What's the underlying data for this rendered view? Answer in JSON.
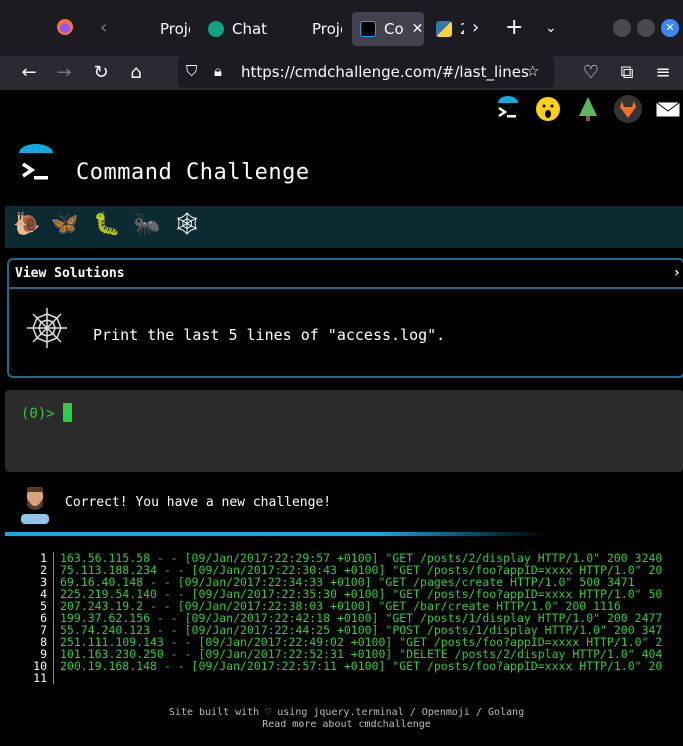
{
  "tabs": [
    {
      "label": "Proje"
    },
    {
      "label": "Chat"
    },
    {
      "label": "Proje"
    },
    {
      "label": "Co"
    },
    {
      "label": "2"
    }
  ],
  "url": "https://cmdchallenge.com/#/last_lines",
  "page": {
    "title": "Command Challenge",
    "solutions_label": "View Solutions",
    "task": "Print the last 5 lines of \"access.log\".",
    "prompt": "(0)>",
    "message": "Correct! You have a new challenge!",
    "output": [
      {
        "n": "1",
        "text": "163.56.115.58 - - [09/Jan/2017:22:29:57 +0100] \"GET /posts/2/display HTTP/1.0\" 200 3240"
      },
      {
        "n": "2",
        "text": "75.113.188.234 - - [09/Jan/2017:22:30:43 +0100] \"GET /posts/foo?appID=xxxx HTTP/1.0\" 20"
      },
      {
        "n": "3",
        "text": "69.16.40.148 - - [09/Jan/2017:22:34:33 +0100] \"GET /pages/create HTTP/1.0\" 500 3471"
      },
      {
        "n": "4",
        "text": "225.219.54.140 - - [09/Jan/2017:22:35:30 +0100] \"GET /posts/foo?appID=xxxx HTTP/1.0\" 50"
      },
      {
        "n": "5",
        "text": "207.243.19.2 - - [09/Jan/2017:22:38:03 +0100] \"GET /bar/create HTTP/1.0\" 200 1116"
      },
      {
        "n": "6",
        "text": "199.37.62.156 - - [09/Jan/2017:22:42:18 +0100] \"GET /posts/1/display HTTP/1.0\" 200 2477"
      },
      {
        "n": "7",
        "text": "55.74.240.123 - - [09/Jan/2017:22:44:25 +0100] \"POST /posts/1/display HTTP/1.0\" 200 347"
      },
      {
        "n": "8",
        "text": "251.111.109.143 - - [09/Jan/2017:22:49:02 +0100] \"GET /posts/foo?appID=xxxx HTTP/1.0\" 2"
      },
      {
        "n": "9",
        "text": "101.163.230.250 - - [09/Jan/2017:22:52:31 +0100] \"DELETE /posts/2/display HTTP/1.0\" 404"
      },
      {
        "n": "10",
        "text": "200.19.168.148 - - [09/Jan/2017:22:57:11 +0100] \"GET /posts/foo?appID=xxxx HTTP/1.0\" 20"
      },
      {
        "n": "11",
        "text": ""
      }
    ],
    "footer_line1": "Site built with ♡ using jquery.terminal / Openmoji / Golang",
    "footer_line2": "Read more about cmdchallenge"
  },
  "icons": {
    "top": [
      "terminal-icon",
      "hushed-face-icon",
      "tree-icon",
      "gitlab-icon",
      "envelope-icon"
    ],
    "levels": [
      "snail-icon",
      "butterfly-icon",
      "caterpillar-icon",
      "ant-icon",
      "spider-web-icon"
    ]
  },
  "colors": {
    "accent": "#15a9e0",
    "terminal_green": "#2ecc40",
    "levels_bg": "#0d2a33"
  }
}
